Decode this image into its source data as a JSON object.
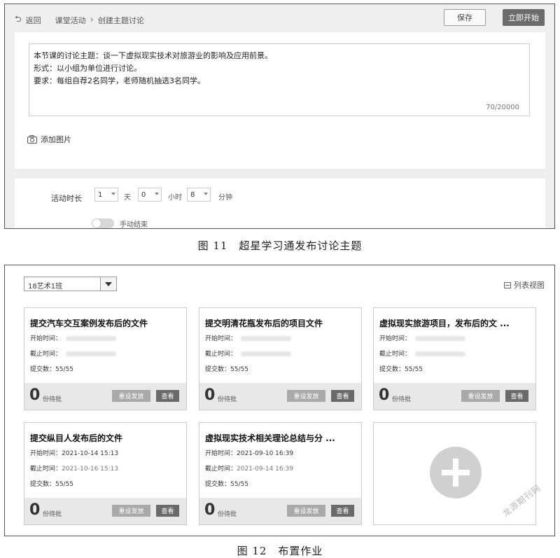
{
  "figure11": {
    "breadcrumb": {
      "back": "返回",
      "level1": "课堂活动",
      "level2": "创建主题讨论"
    },
    "buttons": {
      "save": "保存",
      "start": "立即开始"
    },
    "editor": {
      "line1": "本节课的讨论主题：谈一下虚拟现实技术对旅游业的影响及应用前景。",
      "line2": "形式：以小组为单位进行讨论。",
      "line3": "要求：每组自荐2名同学，老师随机抽选3名同学。",
      "char_count": "70/20000"
    },
    "add_image": "添加图片",
    "duration": {
      "label": "活动时长",
      "days_value": "1",
      "days_unit": "天",
      "hours_value": "0",
      "hours_unit": "小时",
      "minutes_value": "8",
      "minutes_unit": "分钟"
    },
    "manual_end": {
      "label": "手动结束",
      "on": false
    },
    "caption": "图 11　超星学习通发布讨论主题"
  },
  "figure12": {
    "class_select": "18艺术1班",
    "list_view": "列表视图",
    "labels": {
      "start": "开始时间：",
      "end": "截止时间：",
      "submitted": "提交数：",
      "pending": "份待批",
      "reset": "重设发放",
      "view": "查看"
    },
    "cards": [
      {
        "title": "提交汽车交互案例发布后的文件",
        "start": "",
        "end": "",
        "submitted": "55/55",
        "pending": "0"
      },
      {
        "title": "提交明清花瓶发布后的项目文件",
        "start": "",
        "end": "",
        "submitted": "55/55",
        "pending": "0"
      },
      {
        "title": "虚拟现实旅游项目，发布后的文 ...",
        "start": "",
        "end": "",
        "submitted": "55/55",
        "pending": "0"
      },
      {
        "title": "提交纵目人发布后的文件",
        "start": "2021-10-14 15:13",
        "end": "2021-10-16 15:13",
        "submitted": "55/55",
        "pending": "0"
      },
      {
        "title": "虚拟现实技术相关理论总结与分 ...",
        "start": "2021-09-10 16:39",
        "end": "2021-09-14 16:39",
        "submitted": "55/55",
        "pending": "0"
      }
    ],
    "caption": "图 12　布置作业",
    "watermark": "龙源期刊网"
  }
}
